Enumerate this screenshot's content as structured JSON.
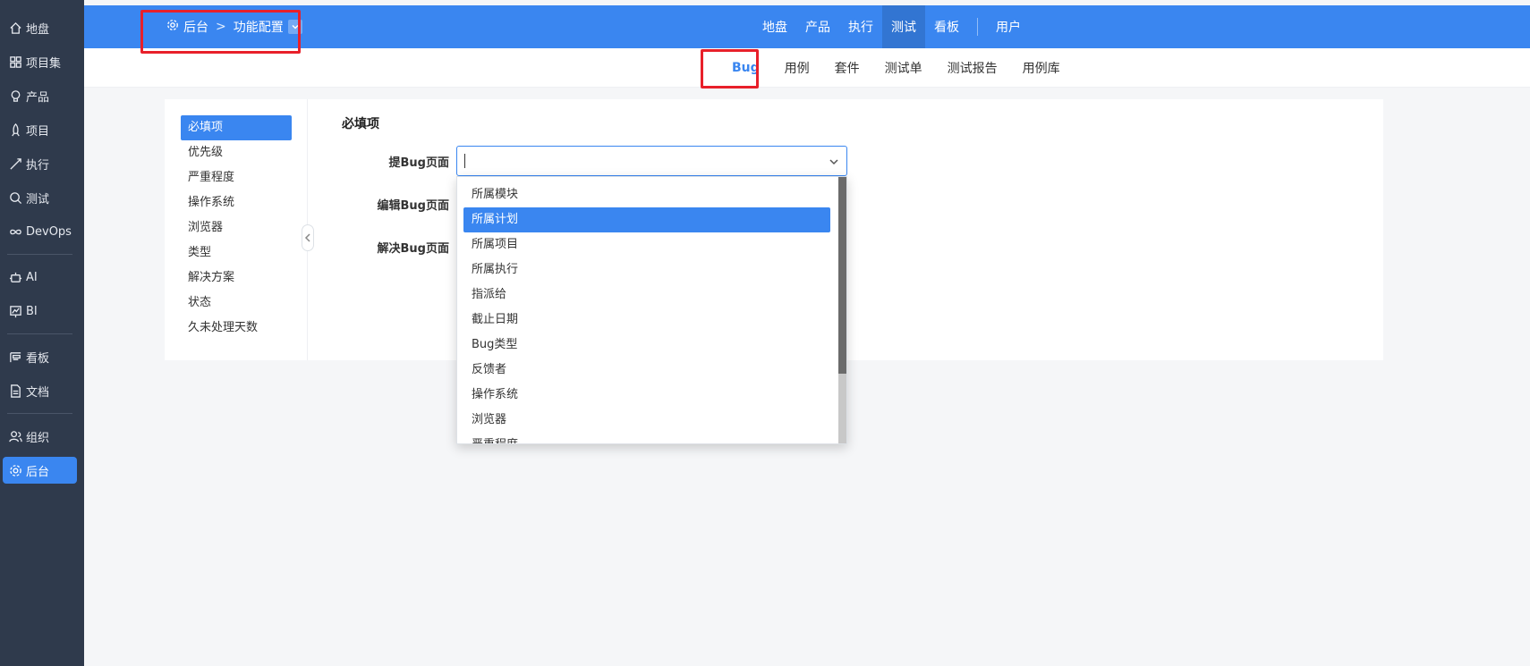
{
  "sidebar": {
    "items": [
      {
        "label": "地盘",
        "icon": "home-icon"
      },
      {
        "label": "项目集",
        "icon": "grid-icon"
      },
      {
        "label": "产品",
        "icon": "bulb-icon"
      },
      {
        "label": "项目",
        "icon": "rocket-icon"
      },
      {
        "label": "执行",
        "icon": "run-icon"
      },
      {
        "label": "测试",
        "icon": "search-icon"
      },
      {
        "label": "DevOps",
        "icon": "infinity-icon"
      },
      {
        "label": "AI",
        "icon": "robot-icon"
      },
      {
        "label": "BI",
        "icon": "chart-icon"
      },
      {
        "label": "看板",
        "icon": "kanban-icon"
      },
      {
        "label": "文档",
        "icon": "document-icon"
      },
      {
        "label": "组织",
        "icon": "users-icon"
      },
      {
        "label": "后台",
        "icon": "gear-icon"
      }
    ],
    "active": "后台"
  },
  "header": {
    "breadcrumb": {
      "root": "后台",
      "sep": ">",
      "current": "功能配置"
    },
    "nav": [
      "地盘",
      "产品",
      "执行",
      "测试",
      "看板"
    ],
    "nav_active": "测试",
    "user_link": "用户",
    "accent": "#3a86f0"
  },
  "subnav": {
    "items": [
      "Bug",
      "用例",
      "套件",
      "测试单",
      "测试报告",
      "用例库"
    ],
    "active": "Bug"
  },
  "leftmenu": {
    "items": [
      "必填项",
      "优先级",
      "严重程度",
      "操作系统",
      "浏览器",
      "类型",
      "解决方案",
      "状态",
      "久未处理天数"
    ],
    "active": "必填项"
  },
  "form": {
    "section_title": "必填项",
    "fields": [
      {
        "label": "提Bug页面"
      },
      {
        "label": "编辑Bug页面"
      },
      {
        "label": "解决Bug页面"
      }
    ],
    "input_value": ""
  },
  "dropdown": {
    "options": [
      "所属模块",
      "所属计划",
      "所属项目",
      "所属执行",
      "指派给",
      "截止日期",
      "Bug类型",
      "反馈者",
      "操作系统",
      "浏览器",
      "严重程度"
    ],
    "highlighted": "所属计划"
  }
}
